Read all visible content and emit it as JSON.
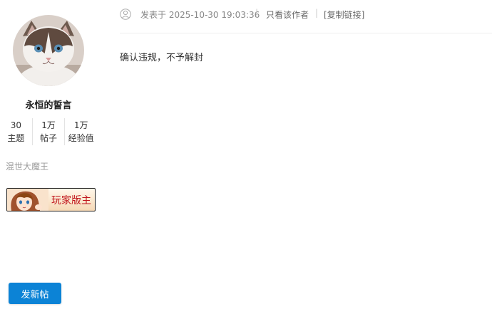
{
  "user": {
    "avatar_icon": "cat-avatar",
    "name": "永恒的誓言",
    "stats": [
      {
        "value": "30",
        "label": "主题"
      },
      {
        "value": "1万",
        "label": "帖子"
      },
      {
        "value": "1万",
        "label": "经验值"
      }
    ],
    "title": "混世大魔王",
    "medal": {
      "icon": "anime-girl-icon",
      "label": "玩家版主",
      "color": "#c0141c"
    }
  },
  "post": {
    "online_icon": "user-outline-icon",
    "posted_at": "发表于 2025-10-30 19:03:36",
    "separator": "|",
    "only_author": "只看该作者",
    "copy_link": "[复制链接]",
    "content": "确认违规，不予解封"
  },
  "actions": {
    "new_thread_label": "发新帖",
    "accent": "#0c83d6"
  }
}
